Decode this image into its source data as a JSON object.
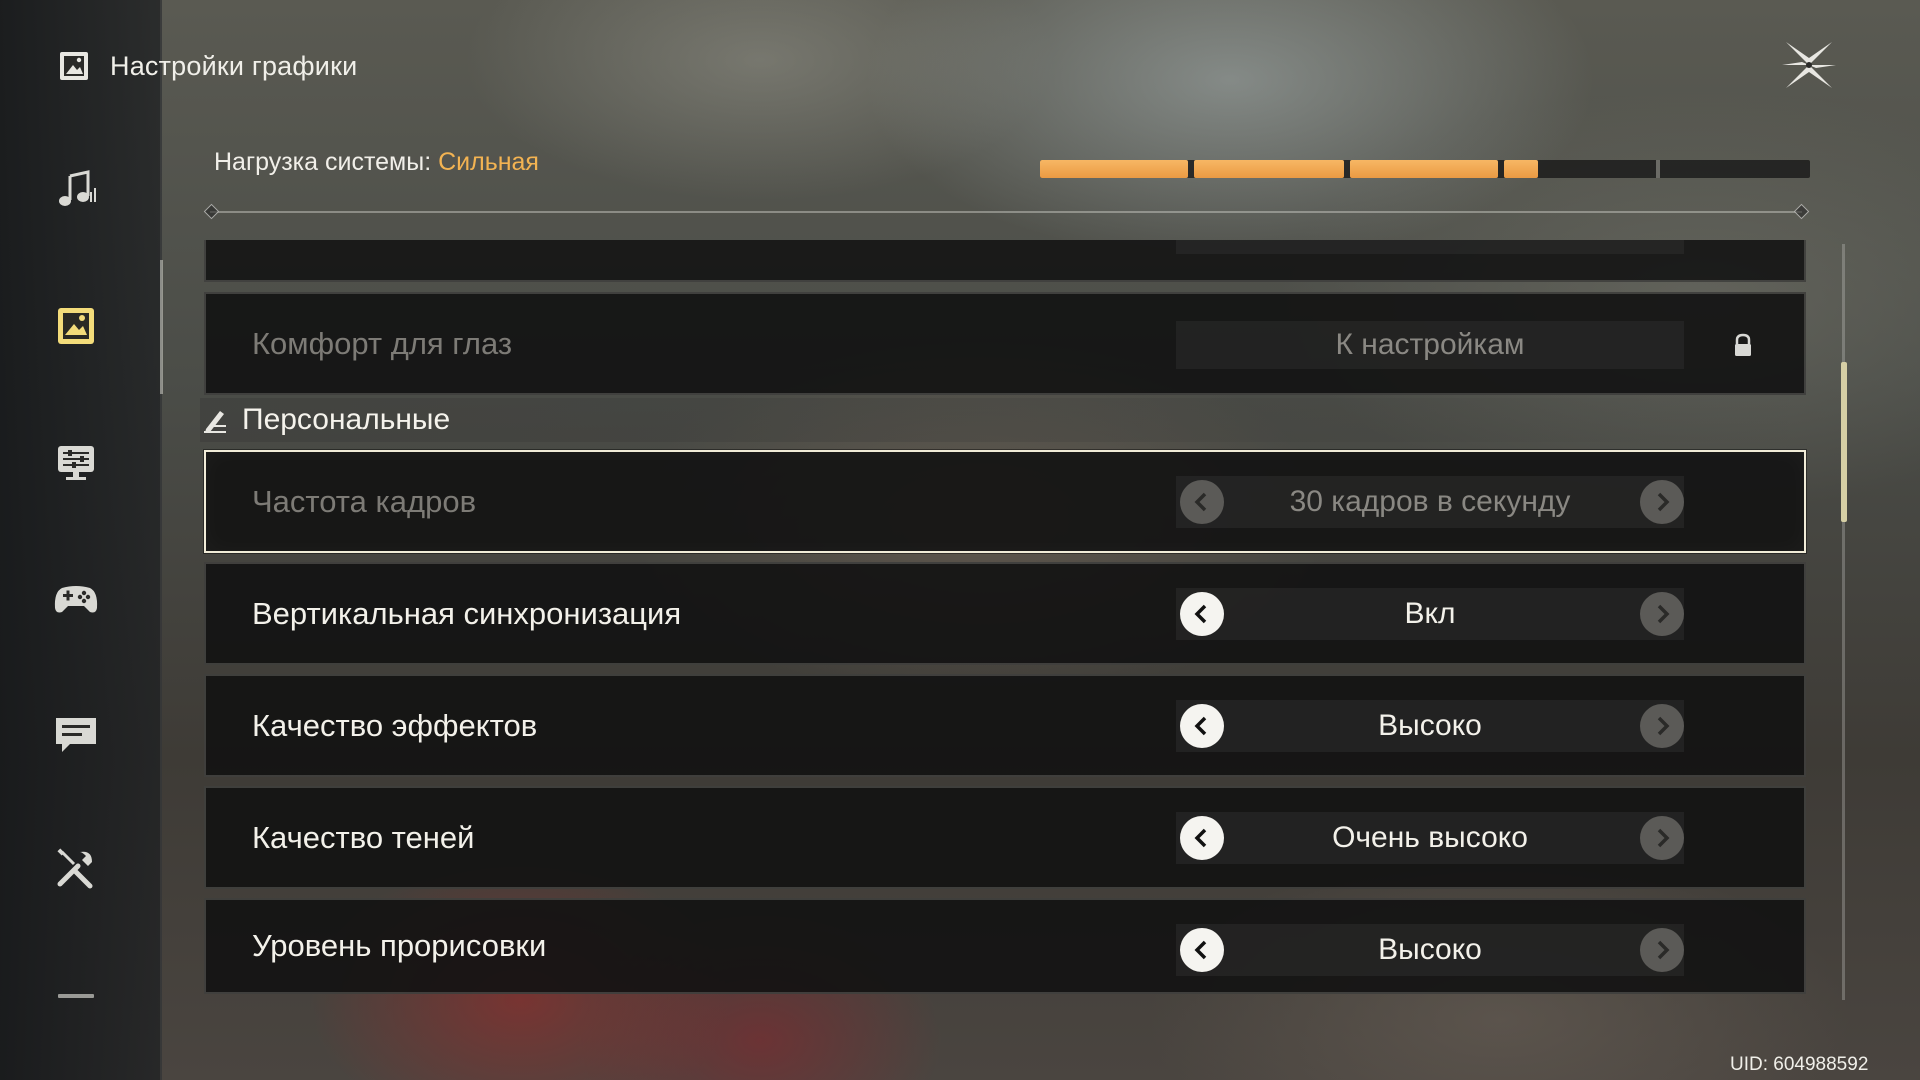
{
  "header": {
    "title": "Настройки графики",
    "icon": "picture-icon"
  },
  "sidebar": {
    "items": [
      {
        "name": "audio",
        "icon": "music-note-icon",
        "active": false
      },
      {
        "name": "graphics",
        "icon": "picture-icon",
        "active": true
      },
      {
        "name": "display",
        "icon": "monitor-sliders-icon",
        "active": false
      },
      {
        "name": "controls",
        "icon": "gamepad-icon",
        "active": false
      },
      {
        "name": "chat",
        "icon": "chat-bubble-icon",
        "active": false
      },
      {
        "name": "other",
        "icon": "tools-icon",
        "active": false
      },
      {
        "name": "more",
        "icon": "dash-icon",
        "active": false
      }
    ]
  },
  "load": {
    "label": "Нагрузка системы:",
    "level": "Сильная",
    "fraction": 0.65,
    "accent_color": "#f3b352"
  },
  "rows": {
    "eye_comfort": {
      "label": "Комфорт для глаз",
      "button": "К настройкам",
      "locked": true
    },
    "section_personal": "Персональные",
    "fps": {
      "label": "Частота кадров",
      "value": "30 кадров в секунду",
      "disabled": true
    },
    "vsync": {
      "label": "Вертикальная синхронизация",
      "value": "Вкл"
    },
    "effects": {
      "label": "Качество эффектов",
      "value": "Высоко"
    },
    "shadows": {
      "label": "Качество теней",
      "value": "Очень высоко"
    },
    "draw_distance": {
      "label": "Уровень прорисовки",
      "value": "Высоко"
    }
  },
  "footer": {
    "uid": "UID: 604988592"
  }
}
